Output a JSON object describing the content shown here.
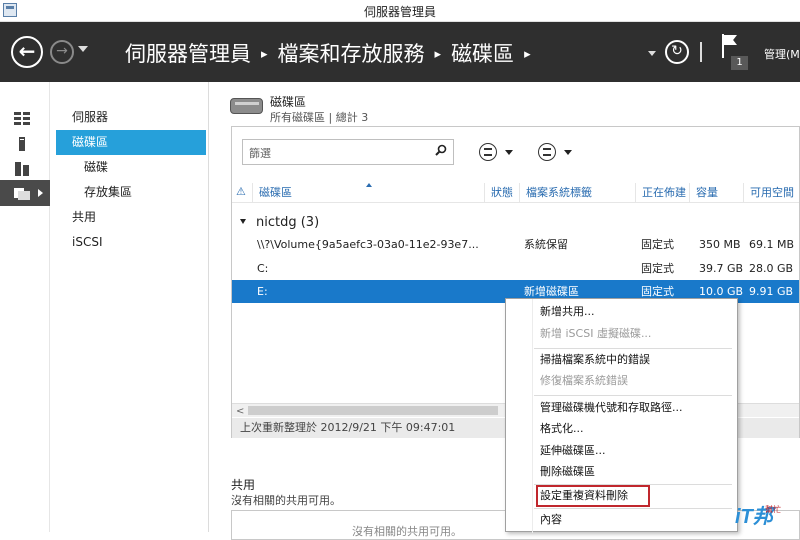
{
  "window": {
    "title": "伺服器管理員"
  },
  "nav": {
    "back_glyph": "←",
    "forward_glyph": "→",
    "crumbs": [
      "伺服器管理員",
      "檔案和存放服務",
      "磁碟區"
    ],
    "crumb_sep": "▸",
    "refresh_glyph": "↻",
    "flag_count": "1",
    "manage": "管理(M"
  },
  "rail": [
    "dashboard-icon",
    "local-server-icon",
    "all-servers-icon",
    "file-storage-icon"
  ],
  "sidebar": {
    "items": [
      {
        "label": "伺服器"
      },
      {
        "label": "磁碟區"
      },
      {
        "label": "磁碟"
      },
      {
        "label": "存放集區"
      },
      {
        "label": "共用"
      },
      {
        "label": "iSCSI"
      }
    ]
  },
  "volumes": {
    "title": "磁碟區",
    "subtitle": "所有磁碟區 | 總計 3",
    "filter_placeholder": "篩選",
    "columns": {
      "warning": "⚠",
      "volume": "磁碟區",
      "status": "狀態",
      "fs_label": "檔案系統標籤",
      "provisioning": "正在佈建",
      "capacity": "容量",
      "free": "可用空間"
    },
    "group": "nictdg (3)",
    "rows": [
      {
        "volume": "\\\\?\\Volume{9a5aefc3-03a0-11e2-93e7...",
        "fs_label": "系統保留",
        "provisioning": "固定式",
        "capacity": "350 MB",
        "free": "69.1 MB"
      },
      {
        "volume": "C:",
        "fs_label": "",
        "provisioning": "固定式",
        "capacity": "39.7 GB",
        "free": "28.0 GB"
      },
      {
        "volume": "E:",
        "fs_label": "新增磁碟區",
        "provisioning": "固定式",
        "capacity": "10.0 GB",
        "free": "9.91 GB"
      }
    ],
    "scroll_left": "<",
    "status": "上次重新整理於 2012/9/21 下午 09:47:01"
  },
  "shares": {
    "title": "共用",
    "subtitle": "沒有相關的共用可用。",
    "empty": "沒有相關的共用可用。"
  },
  "context_menu": {
    "items": [
      {
        "label": "新增共用..."
      },
      {
        "label": "新增 iSCSI 虛擬磁碟..."
      },
      {
        "label": "掃描檔案系統中的錯誤"
      },
      {
        "label": "修復檔案系統錯誤"
      },
      {
        "label": "管理磁碟機代號和存取路徑..."
      },
      {
        "label": "格式化..."
      },
      {
        "label": "延伸磁碟區..."
      },
      {
        "label": "刪除磁碟區"
      },
      {
        "label": "設定重複資料刪除"
      },
      {
        "label": "內容"
      }
    ]
  },
  "watermark": {
    "logo": "iT邦",
    "small": "幫忙"
  },
  "colors": {
    "selection": "#26a0da",
    "row_selected": "#1979ca",
    "navband": "#2f2f2f",
    "highlight_box": "#c0272d"
  }
}
